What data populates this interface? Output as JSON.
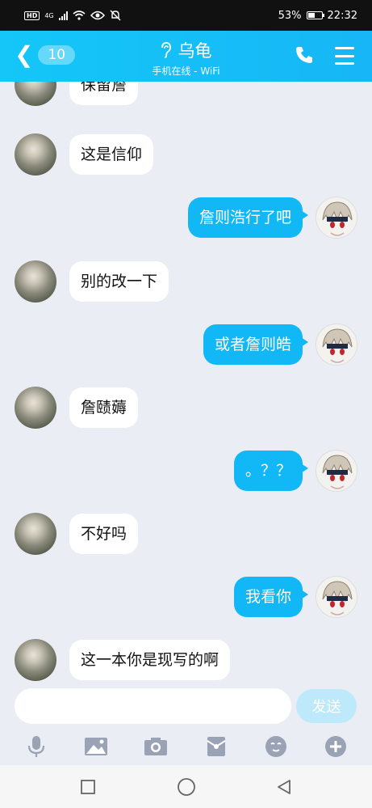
{
  "status_bar": {
    "network": "4G",
    "hd": "HD",
    "battery": "53%",
    "battery_level": 0.53,
    "time": "22:32",
    "icons": [
      "hd-icon",
      "signal-icon",
      "wifi-icon",
      "eye-icon",
      "mute-bell-icon",
      "battery-icon"
    ]
  },
  "header": {
    "back_count": "10",
    "title": "乌龟",
    "subtitle": "手机在线 - WiFi",
    "accent_color": "#12b7f5"
  },
  "messages": [
    {
      "side": "in",
      "text": "保留詹"
    },
    {
      "side": "in",
      "text": "这是信仰"
    },
    {
      "side": "out",
      "text": "詹则浩行了吧"
    },
    {
      "side": "in",
      "text": "别的改一下"
    },
    {
      "side": "out",
      "text": "或者詹则皓"
    },
    {
      "side": "in",
      "text": "詹赜薅"
    },
    {
      "side": "out",
      "text": "。？？"
    },
    {
      "side": "in",
      "text": "不好吗"
    },
    {
      "side": "out",
      "text": "我看你"
    },
    {
      "side": "in",
      "text": "这一本你是现写的啊"
    }
  ],
  "composer": {
    "input_value": "",
    "send_label": "发送"
  },
  "toolbar": [
    "microphone-icon",
    "image-icon",
    "camera-icon",
    "red-packet-icon",
    "emoji-icon",
    "plus-icon"
  ],
  "nav_bar": [
    "square-recent-icon",
    "circle-home-icon",
    "triangle-back-icon"
  ]
}
